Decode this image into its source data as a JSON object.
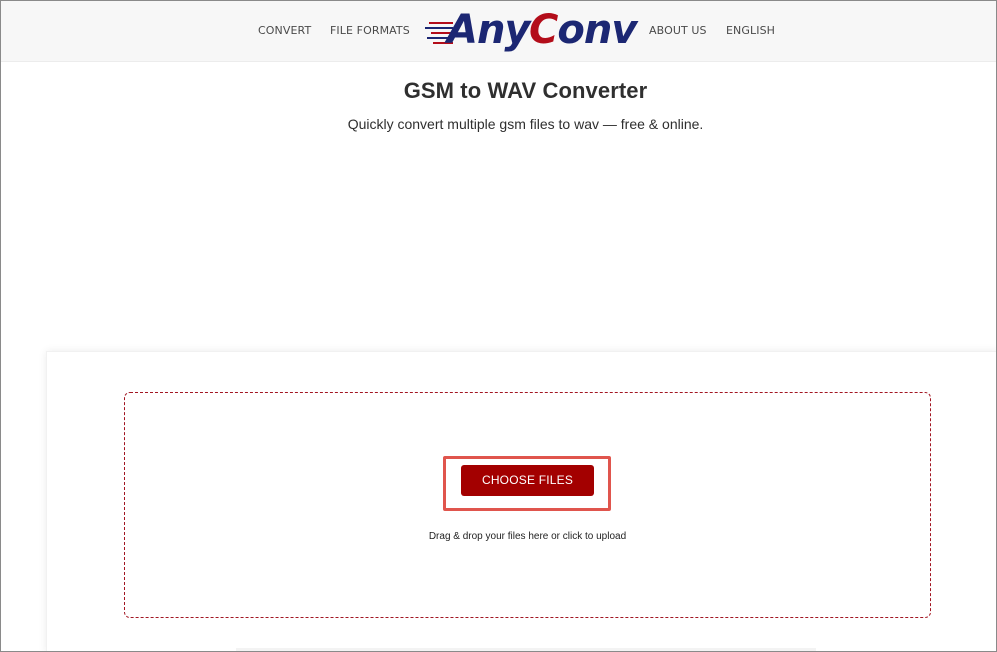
{
  "nav": {
    "convert": "CONVERT",
    "file_formats": "FILE FORMATS",
    "about_us": "ABOUT US",
    "language": "ENGLISH"
  },
  "logo": {
    "part1": "Any",
    "part2_c": "C",
    "part2_rest": "onv"
  },
  "main": {
    "title": "GSM to WAV Converter",
    "subtitle": "Quickly convert multiple gsm files to wav — free & online."
  },
  "upload": {
    "button_label": "CHOOSE FILES",
    "hint": "Drag & drop your files here or click to upload"
  },
  "colors": {
    "brand_blue": "#1c2773",
    "brand_red": "#b30d1a",
    "button_red": "#a30000",
    "highlight_red": "#e0554d"
  }
}
